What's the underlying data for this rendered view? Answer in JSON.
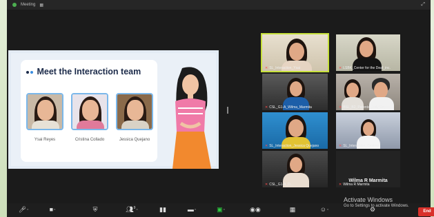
{
  "window": {
    "title": "Meeting"
  },
  "share": {
    "title": "Meet the Interaction team",
    "members": [
      {
        "name": "Ysai Reyes"
      },
      {
        "name": "Cristina Collado"
      },
      {
        "name": "Jessica Quejano"
      }
    ]
  },
  "gallery": [
    {
      "label": "SL_Interaction_Ysai"
    },
    {
      "label": "LSBK_Center for the Deaf_inc."
    },
    {
      "label": "CSL_G1-A_Wilma_Marmita"
    },
    {
      "label": "BSL_B2_Parents_Judy Reyes"
    },
    {
      "label": "SL_Interaction_Jessica Quejano"
    },
    {
      "label": "SL_Interaction_Cristina"
    },
    {
      "label": "CSL_G1-A_D..."
    },
    {
      "label": "Wilma R Marmita",
      "bigname": "Wilma R Marmita"
    }
  ],
  "toolbar": {
    "participants_count": "9",
    "end_label": "End"
  },
  "os": {
    "activate_title": "Activate Windows",
    "activate_sub": "Go to Settings to activate Windows."
  },
  "colors": {
    "active_speaker_outline": "#c6e03a",
    "end_button": "#d9302a",
    "photo_border": "#7ab7ea",
    "title_text": "#1c2b4a"
  }
}
